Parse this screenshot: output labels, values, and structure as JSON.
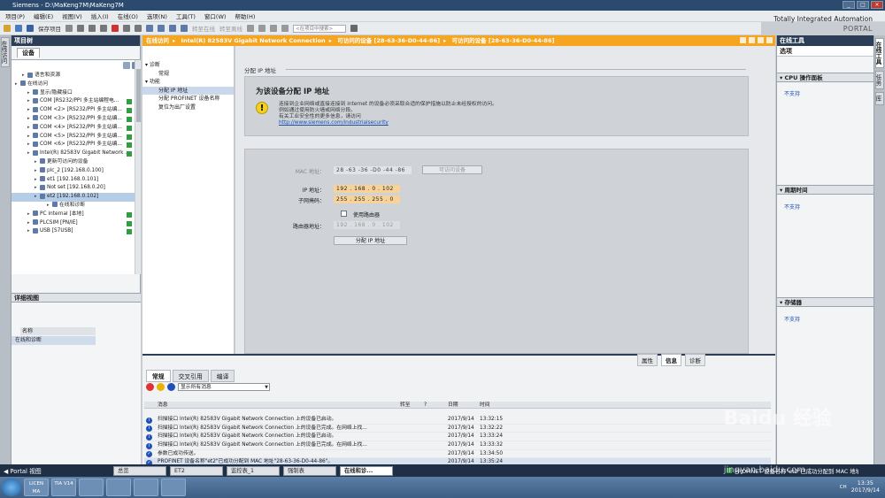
{
  "titlebar": {
    "title": "Siemens - D:\\MaKeng7M\\MaKeng7M"
  },
  "menu": [
    "项目(P)",
    "编辑(E)",
    "视图(V)",
    "插入(I)",
    "在线(O)",
    "选项(N)",
    "工具(T)",
    "窗口(W)",
    "帮助(H)"
  ],
  "toolbar": {
    "save": "保存项目",
    "go_online": "转至在线",
    "go_offline": "转至离线",
    "search_placeholder": "<在项目中搜索>"
  },
  "brand": {
    "line1": "Totally Integrated Automation",
    "line2": "PORTAL"
  },
  "left_strip": {
    "label": "在线访问"
  },
  "project": {
    "header": "项目树",
    "tab": "设备",
    "tree": [
      {
        "label": "语言和资源",
        "flag": false,
        "sel": false
      },
      {
        "label": "在线访问",
        "flag": false,
        "sel": false
      },
      {
        "label": "显示/隐藏接口",
        "flag": false,
        "sel": false
      },
      {
        "label": "COM [RS232/PPI 多主站编程电...",
        "flag": true,
        "sel": false
      },
      {
        "label": "COM <2> [RS232/PPI 多主站编...",
        "flag": true,
        "sel": false
      },
      {
        "label": "COM <3> [RS232/PPI 多主站编...",
        "flag": true,
        "sel": false
      },
      {
        "label": "COM <4> [RS232/PPI 多主站编...",
        "flag": true,
        "sel": false
      },
      {
        "label": "COM <5> [RS232/PPI 多主站编...",
        "flag": true,
        "sel": false
      },
      {
        "label": "COM <6> [RS232/PPI 多主站编...",
        "flag": true,
        "sel": false
      },
      {
        "label": "Intel(R) 82583V Gigabit Network ...",
        "flag": true,
        "sel": false
      },
      {
        "label": "更新可访问的设备",
        "flag": false,
        "sel": false
      },
      {
        "label": "plc_2 [192.168.0.100]",
        "flag": false,
        "sel": false
      },
      {
        "label": "et1 [192.168.0.101]",
        "flag": false,
        "sel": false
      },
      {
        "label": "Not set [192.168.0.20]",
        "flag": false,
        "sel": false
      },
      {
        "label": "et2 [192.168.0.102]",
        "flag": false,
        "sel": true
      },
      {
        "label": "在线和诊断",
        "flag": false,
        "sel": false
      },
      {
        "label": "PC internal [本地]",
        "flag": true,
        "sel": false
      },
      {
        "label": "PLCSIM [PN/IE]",
        "flag": true,
        "sel": false
      },
      {
        "label": "USB [S7USB]",
        "flag": true,
        "sel": false
      }
    ],
    "detail_header": "详细视图",
    "detail_col": "名称",
    "detail_item": "在线和诊断"
  },
  "breadcrumb": [
    "在线访问",
    "Intel(R) 82583V Gigabit Network Connection",
    "可访问的设备 [28-63-36-D0-44-86]",
    "可访问的设备 [28-63-36-D0-44-86]"
  ],
  "nav": {
    "diag": "诊断",
    "general": "常规",
    "func": "功能",
    "assign_ip": "分配 IP 地址",
    "assign_name": "分配 PROFINET 设备名称",
    "reset": "复位为出厂设置"
  },
  "content": {
    "section": "分配 IP 地址",
    "info_title": "为该设备分配 IP 地址",
    "info_line1": "连接到企业网络或直接连接到 internet 的设备必须采取合适的保护措施以防止未经授权的访问。",
    "info_line2": "例如通过使用防火墙或网络分段。",
    "info_line3": "有关工业安全性的更多信息，请访问",
    "info_link": "http://www.siemens.com/industrialsecurity",
    "mac_label": "MAC 地址：",
    "mac_value": "28 -63 -36 -D0 -44 -86",
    "accessible_btn": "可访问设备",
    "ip_label": "IP 地址：",
    "ip_value": "192 . 168 . 0 . 102",
    "mask_label": "子网掩码：",
    "mask_value": "255 . 255 . 255 . 0",
    "router_chk": "使用路由器",
    "router_label": "路由器地址：",
    "router_value": "192 . 168 . 0 . 102",
    "assign_btn": "分配 IP 地址"
  },
  "inspector": {
    "tabs": [
      "属性",
      "信息",
      "诊断"
    ],
    "subtabs": [
      "常规",
      "交叉引用",
      "编译"
    ],
    "filter": "显示所有消息"
  },
  "messages": {
    "headers": {
      "msg": "消息",
      "goto": "转至",
      "q": "?",
      "date": "日期",
      "time": "时间"
    },
    "rows": [
      {
        "msg": "扫描接口 Intel(R) 82583V Gigabit Network Connection 上的设备已启动。",
        "date": "2017/9/14",
        "time": "13:32:15",
        "ok": false
      },
      {
        "msg": "扫描接口 Intel(R) 82583V Gigabit Network Connection 上的设备已完成。在网络上找...",
        "date": "2017/9/14",
        "time": "13:32:22",
        "ok": false
      },
      {
        "msg": "扫描接口 Intel(R) 82583V Gigabit Network Connection 上的设备已启动。",
        "date": "2017/9/14",
        "time": "13:33:24",
        "ok": false
      },
      {
        "msg": "扫描接口 Intel(R) 82583V Gigabit Network Connection 上的设备已完成。在网络上找...",
        "date": "2017/9/14",
        "time": "13:33:32",
        "ok": false
      },
      {
        "msg": "参数已成功传送。",
        "date": "2017/9/14",
        "time": "13:34:50",
        "ok": true
      },
      {
        "msg": "PROFINET 设备名称\"et2\"已成功分配到 MAC 地址\"28-63-36-D0-44-86\"。",
        "date": "2017/9/14",
        "time": "13:35:24",
        "ok": true
      }
    ]
  },
  "tools": {
    "header": "在线工具",
    "options": "选项",
    "cpu": "CPU 操作面板",
    "cpu_val": "不支持",
    "cycle": "周期时间",
    "cycle_val": "不支持",
    "mem": "存储器",
    "mem_val": "不支持"
  },
  "right_strip": [
    "在线工具",
    "任务",
    "库"
  ],
  "portal": {
    "label": "Portal 视图",
    "tabs": [
      "总览",
      "ET2",
      "监控表_1",
      "强制表",
      "在线和诊..."
    ],
    "status": "PROFINET 设备名称\"et2\"已成功分配到 MAC 地址\"28-63-36-D0-44-86\"。"
  },
  "taskbar": {
    "apps": [
      "LICEN MA",
      "TIA V14"
    ],
    "clock_time": "13:35",
    "clock_date": "2017/9/14",
    "lang": "CH"
  },
  "watermark": {
    "text": "Baidu 经验",
    "url": "jingyan.baidu.com"
  },
  "colors": {
    "orange": "#f5a520",
    "header": "#2c3e55",
    "accent": "#1f4fb8"
  }
}
